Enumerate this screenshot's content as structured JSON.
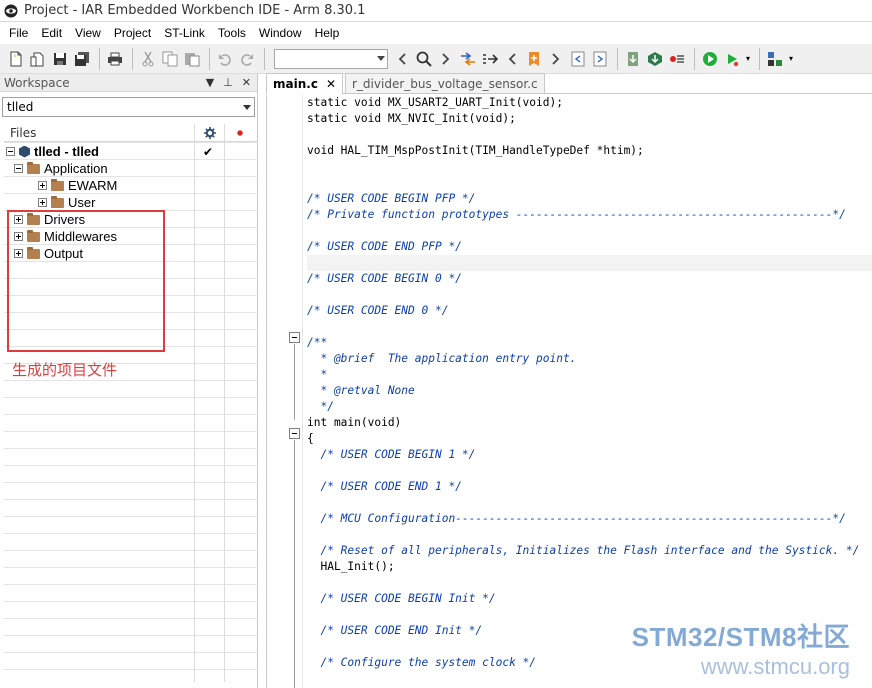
{
  "window": {
    "title": "Project - IAR Embedded Workbench IDE - Arm 8.30.1"
  },
  "menu": [
    "File",
    "Edit",
    "View",
    "Project",
    "ST-Link",
    "Tools",
    "Window",
    "Help"
  ],
  "toolbar": {
    "icons": [
      "new-file-icon",
      "open-icon",
      "save-icon",
      "save-all-icon",
      "print-icon",
      "cut-icon",
      "copy-icon",
      "paste-icon",
      "undo-icon",
      "redo-icon",
      "find-prev-icon",
      "find-icon",
      "find-next-icon",
      "goto-icon",
      "bookmark-icon",
      "prev-bookmark-icon",
      "toggle-bookmark-icon",
      "next-bookmark-icon",
      "prev-breakpoint-icon",
      "next-breakpoint-icon",
      "compile-icon",
      "make-icon",
      "stop-build-icon",
      "debug-download-icon",
      "debug-icon",
      "ide-settings-icon"
    ],
    "search_value": ""
  },
  "workspace": {
    "header": "Workspace",
    "selected_config": "tlled",
    "files_header": "Files",
    "tree": [
      {
        "label": "tlled - tlled",
        "level": 0,
        "type": "project",
        "expander": "minus",
        "checked": true
      },
      {
        "label": "Application",
        "level": 1,
        "type": "folder",
        "expander": "minus"
      },
      {
        "label": "EWARM",
        "level": 2,
        "type": "folder",
        "expander": "plus"
      },
      {
        "label": "User",
        "level": 2,
        "type": "folder",
        "expander": "plus"
      },
      {
        "label": "Drivers",
        "level": 1,
        "type": "folder",
        "expander": "plus"
      },
      {
        "label": "Middlewares",
        "level": 1,
        "type": "folder",
        "expander": "plus"
      },
      {
        "label": "Output",
        "level": 1,
        "type": "folder",
        "expander": "plus"
      }
    ],
    "annotation": "生成的项目文件",
    "annotation_color": "#e03c3c"
  },
  "editor": {
    "tabs": [
      {
        "label": "main.c",
        "active": true
      },
      {
        "label": "r_divider_bus_voltage_sensor.c",
        "active": false
      }
    ],
    "lines": [
      {
        "text": "static void MX_USART2_UART_Init(void);",
        "comment": false
      },
      {
        "text": "static void MX_NVIC_Init(void);",
        "comment": false
      },
      {
        "text": "",
        "comment": false
      },
      {
        "text": "void HAL_TIM_MspPostInit(TIM_HandleTypeDef *htim);",
        "comment": false
      },
      {
        "text": "",
        "comment": false
      },
      {
        "text": "",
        "comment": false
      },
      {
        "text": "/* USER CODE BEGIN PFP */",
        "comment": true
      },
      {
        "text": "/* Private function prototypes -----------------------------------------------*/",
        "comment": true
      },
      {
        "text": "",
        "comment": false
      },
      {
        "text": "/* USER CODE END PFP */",
        "comment": true
      },
      {
        "text": "",
        "comment": false,
        "highlight": true
      },
      {
        "text": "/* USER CODE BEGIN 0 */",
        "comment": true
      },
      {
        "text": "",
        "comment": false
      },
      {
        "text": "/* USER CODE END 0 */",
        "comment": true
      },
      {
        "text": "",
        "comment": false
      },
      {
        "text": "/**",
        "comment": true
      },
      {
        "text": "  * @brief  The application entry point.",
        "comment": true
      },
      {
        "text": "  *",
        "comment": true
      },
      {
        "text": "  * @retval None",
        "comment": true
      },
      {
        "text": "  */",
        "comment": true
      },
      {
        "text": "int main(void)",
        "comment": false
      },
      {
        "text": "{",
        "comment": false
      },
      {
        "text": "  /* USER CODE BEGIN 1 */",
        "comment": true
      },
      {
        "text": "",
        "comment": false
      },
      {
        "text": "  /* USER CODE END 1 */",
        "comment": true
      },
      {
        "text": "",
        "comment": false
      },
      {
        "text": "  /* MCU Configuration--------------------------------------------------------*/",
        "comment": true
      },
      {
        "text": "",
        "comment": false
      },
      {
        "text": "  /* Reset of all peripherals, Initializes the Flash interface and the Systick. */",
        "comment": true
      },
      {
        "text": "  HAL_Init();",
        "comment": false
      },
      {
        "text": "",
        "comment": false
      },
      {
        "text": "  /* USER CODE BEGIN Init */",
        "comment": true
      },
      {
        "text": "",
        "comment": false
      },
      {
        "text": "  /* USER CODE END Init */",
        "comment": true
      },
      {
        "text": "",
        "comment": false
      },
      {
        "text": "  /* Configure the system clock */",
        "comment": true
      }
    ]
  },
  "watermark": {
    "line1": "STM32/STM8社区",
    "line2": "www.stmcu.org"
  }
}
